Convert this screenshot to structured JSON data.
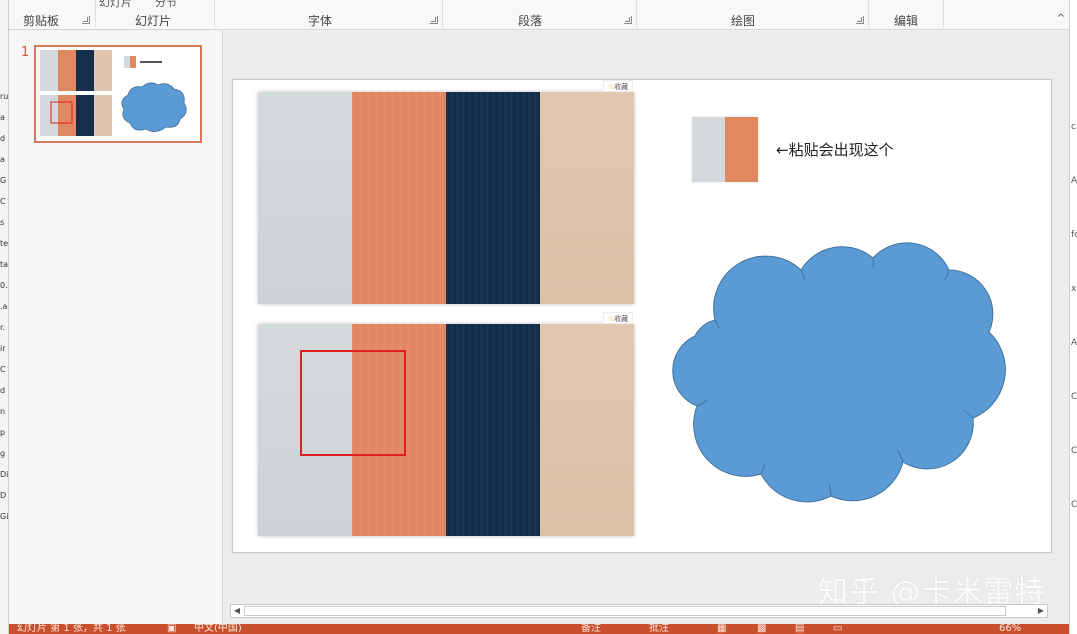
{
  "ribbon": {
    "top_fragments": [
      "幻灯片",
      "分节"
    ],
    "groups": [
      "剪贴板",
      "幻灯片",
      "字体",
      "段落",
      "绘图",
      "编辑"
    ],
    "collapse_glyph": "^"
  },
  "left_strip": {
    "fragments": [
      "ru",
      "a",
      "d",
      "a",
      "G",
      "C",
      "s",
      "te",
      "ta",
      "0.",
      ".a",
      "r.",
      "ir",
      "C",
      "d",
      "n",
      "p",
      "g",
      "Di",
      "D",
      "Gi"
    ]
  },
  "right_strip": {
    "fragments": [
      "c",
      "A",
      "fc",
      "xi",
      "A",
      "C",
      "C",
      "C"
    ]
  },
  "thumbnail_pane": {
    "slide_number": "1"
  },
  "slide": {
    "fav_tag": "收藏",
    "paste_caption": "←粘贴会出现这个",
    "watermark": "知乎 @卡米雷特"
  },
  "colors": {
    "accent": "#c9502e",
    "stripe_gray": "#d3d9dd",
    "stripe_orange": "#e2885f",
    "stripe_navy": "#152e4b",
    "stripe_beige": "#dfc5ad",
    "cloud_fill": "#5b9bd5",
    "cloud_stroke": "#41719c",
    "selection_box": "#e02020"
  },
  "statusbar": {
    "slide_info": "幻灯片 第 1 张，共 1 张",
    "language": "中文(中国)",
    "notes": "备注",
    "comments": "批注",
    "zoom": "66%"
  }
}
